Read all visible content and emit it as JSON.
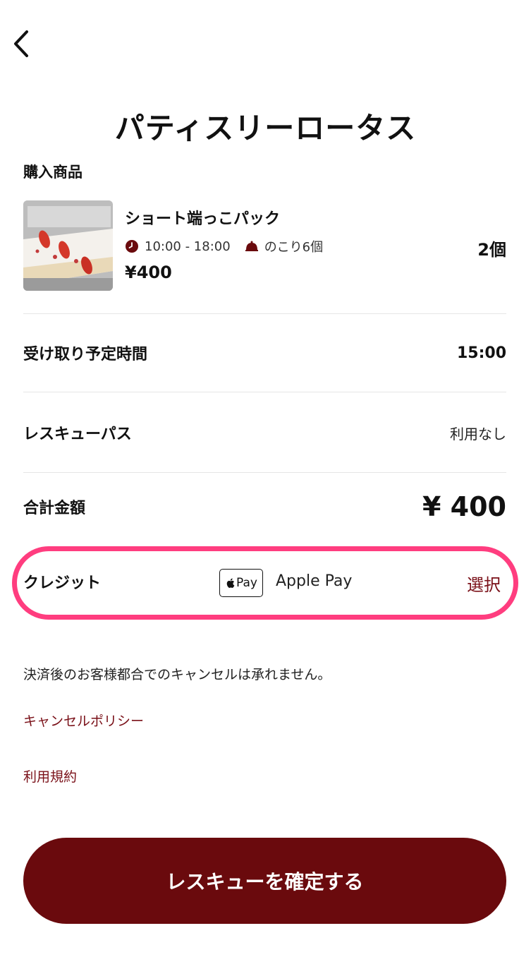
{
  "header": {
    "back_icon": "chevron-left-icon",
    "store_name": "パティスリーロータス"
  },
  "purchase": {
    "section_label": "購入商品",
    "product": {
      "name": "ショート端っこパック",
      "hours": "10:00 - 18:00",
      "remaining": "のこり6個",
      "price": "¥400",
      "quantity": "2個",
      "clock_icon": "clock-icon",
      "dish_icon": "cloche-icon"
    }
  },
  "pickup": {
    "label": "受け取り予定時間",
    "value": "15:00"
  },
  "rescue_pass": {
    "label": "レスキューパス",
    "value": "利用なし"
  },
  "total": {
    "label": "合計金額",
    "value": "¥ 400"
  },
  "payment": {
    "label": "クレジット",
    "logo_text": "Pay",
    "method": "Apple Pay",
    "select_label": "選択"
  },
  "notice": "決済後のお客様都合でのキャンセルは承れません。",
  "links": {
    "cancel_policy": "キャンセルポリシー",
    "terms": "利用規約"
  },
  "confirm_button": "レスキューを確定する",
  "colors": {
    "accent": "#6a0a0d",
    "link": "#7a1018",
    "highlight": "#ff3d7f"
  }
}
